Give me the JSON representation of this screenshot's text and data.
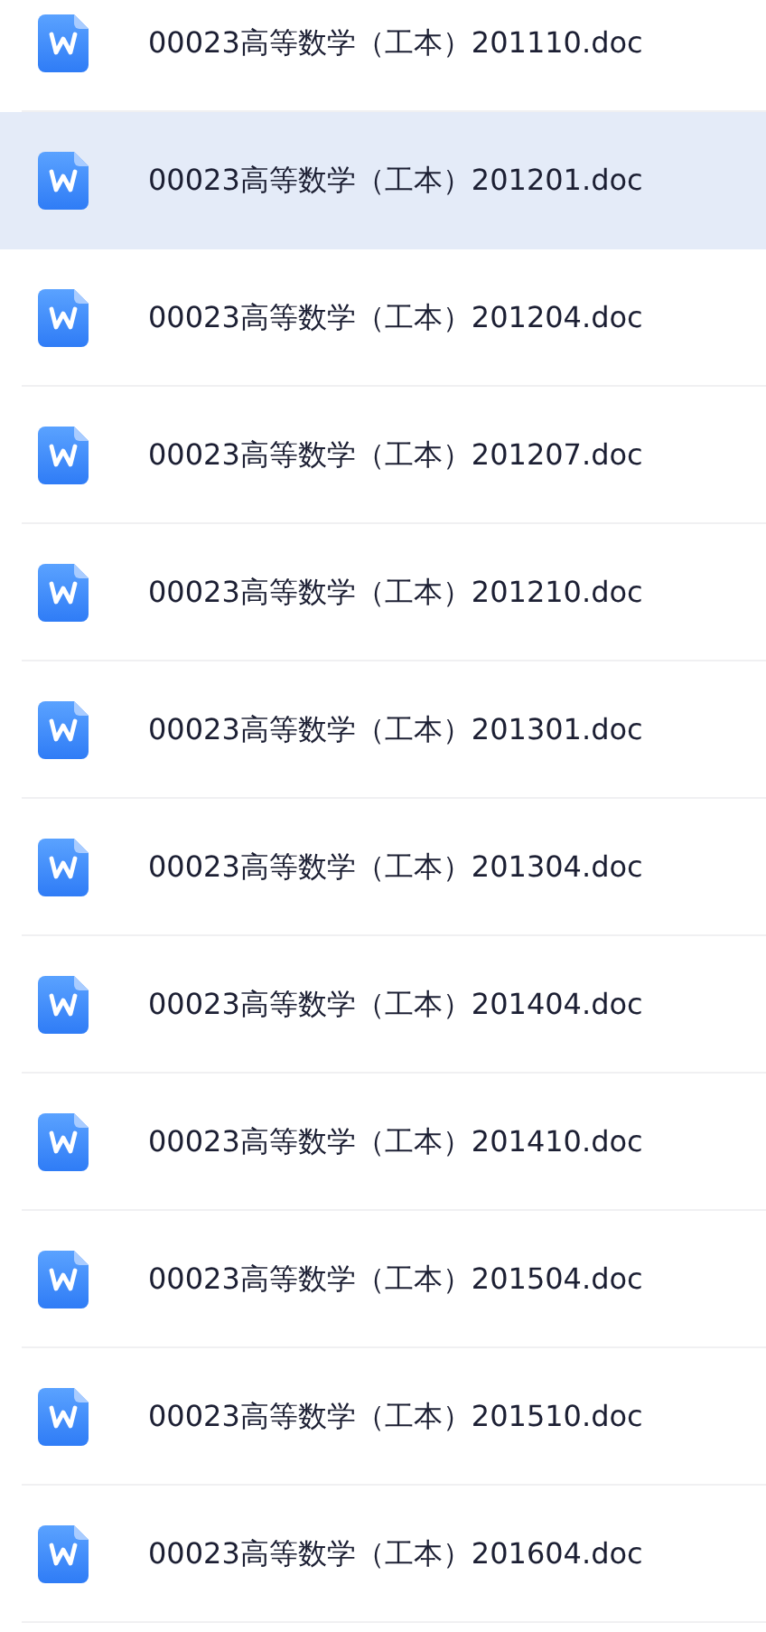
{
  "files": [
    {
      "name": "00023高等数学（工本）201110.doc",
      "selected": false
    },
    {
      "name": "00023高等数学（工本）201201.doc",
      "selected": true
    },
    {
      "name": "00023高等数学（工本）201204.doc",
      "selected": false
    },
    {
      "name": "00023高等数学（工本）201207.doc",
      "selected": false
    },
    {
      "name": "00023高等数学（工本）201210.doc",
      "selected": false
    },
    {
      "name": "00023高等数学（工本）201301.doc",
      "selected": false
    },
    {
      "name": "00023高等数学（工本）201304.doc",
      "selected": false
    },
    {
      "name": "00023高等数学（工本）201404.doc",
      "selected": false
    },
    {
      "name": "00023高等数学（工本）201410.doc",
      "selected": false
    },
    {
      "name": "00023高等数学（工本）201504.doc",
      "selected": false
    },
    {
      "name": "00023高等数学（工本）201510.doc",
      "selected": false
    },
    {
      "name": "00023高等数学（工本）201604.doc",
      "selected": false
    }
  ]
}
